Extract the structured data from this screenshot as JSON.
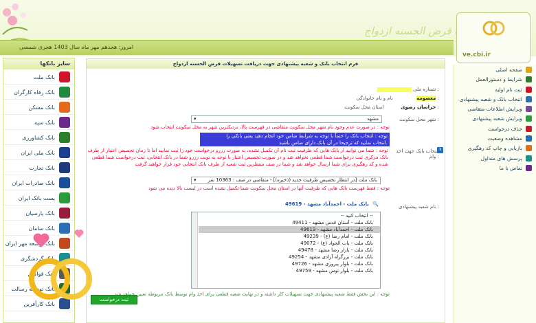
{
  "header": {
    "brand_text": "سامانه تسهیلات قرض الحسنه ازدواج",
    "logo_text": "ve.cbi.ir",
    "date_text": "امروز: هجدهم مهر ماه سال 1403 هجری شمسی"
  },
  "left_sidebar": {
    "title": "سایر بانکها",
    "banks": [
      {
        "label": "بانک ملت",
        "color": "#d0152a"
      },
      {
        "label": "بانک رفاه کارگران",
        "color": "#1f8a3b"
      },
      {
        "label": "بانک مسکن",
        "color": "#e36b1b"
      },
      {
        "label": "بانک سپه",
        "color": "#6b2a8b"
      },
      {
        "label": "بانک کشاورزی",
        "color": "#2a7f2a"
      },
      {
        "label": "بانک ملی ایران",
        "color": "#1b3f8f"
      },
      {
        "label": "بانک تجارت",
        "color": "#1a3c7a"
      },
      {
        "label": "بانک صادرات ایران",
        "color": "#1b4e9a"
      },
      {
        "label": "پست بانک ایران",
        "color": "#2a9b3a"
      },
      {
        "label": "بانک پارسیان",
        "color": "#9a1b3a"
      },
      {
        "label": "بانک سامان",
        "color": "#2a6fb5"
      },
      {
        "label": "بانک توسعه مهر ایران",
        "color": "#c24a1a"
      },
      {
        "label": "بانک گردشگری",
        "color": "#1a8f8f"
      },
      {
        "label": "بانک قوامین",
        "color": "#5a5a5a"
      },
      {
        "label": "بانک توسعه رسالت",
        "color": "#1f6d2f"
      },
      {
        "label": "بانک کارآفرین",
        "color": "#2a4f8f"
      }
    ]
  },
  "form": {
    "title": "فرم انتخاب بانک و شعبه پیشنهادی جهت دریافت تسهیلات قرض الحسنه ازدواج",
    "national_code_label": "شماره ملی :",
    "name_label": "نام و نام خانوادگی :",
    "name_value": "معصومه",
    "province_label": "استان محل سکونت :",
    "province_value": "خراسان رضوی",
    "city_label": "شهر محل سکونت :",
    "city_value": "مشهد",
    "city_note": "توجه : در صورت عدم وجود نام شهر محل سکونت متقاضی در فهرست بالا، نزدیکترین شهر به محل سکونت انتخاب شود",
    "blue_note_1": "توجه : انتخاب بانک را حتماً با توجه به شرایط ضامن خود انجام دهید یعنی بانکی را",
    "blue_note_2": "انتخاب نمایید که ترجیحا در آن بانک دارای ضامن باشید.",
    "bank_select_label": "انتخاب بانک جهت اخذ وام :",
    "bank_warning": "توجه : شما می توانید از بانک هایی که ظرفیت ثبت نام آن تکمیل نشده، به صورت رزرو درخواست خود را ثبت نمایید اما تا زمان تخصیص اعتبار از طرف بانک مرکزی ثبت درخواست شما قطعی نخواهد شد و در صورت تخصیص اعتبار با توجه به نوبت رزرو شما در بانک انتخابی، ثبت درخواست شما قطعی شده و کد رهگیری برای شما ارسال خواهد شد و شما در صف منتظرین ثبت شعبه از طرف بانک انتخابی خود قرار خواهید گرفت",
    "bank_select_value": "بانک ملت [در انتظار تخصیص ظرفیت جدید (ذخیره)] - متقاضی در صف : 10363 نفر",
    "bank_note": "توجه : فقط فهرست بانک هایی که ظرفیت آنها در استان محل سکونت شما تکمیل نشده است در لیست بالا دیده می شود",
    "branch_label": "نام شعبه پیشنهادی :",
    "branch_selected": "بانک ملت - احمدآباد مشهد - 49619",
    "branch_options": [
      "-- انتخاب کنید --",
      "بانک ملت - آستان قدس مشهد - 49411",
      "بانک ملت - احمدآباد مشهد - 49619",
      "بانک ملت - امام رضا (ع) - 49239",
      "بانک ملت - باب الجواد (ع) - 49072",
      "بانک ملت - بازار رضا مشهد - 49478",
      "بانک ملت - بزرگراه آزادی مشهد - 49254",
      "بانک ملت - بلوار پیروزی مشهد - 49726",
      "بانک ملت - بلوار توس مشهد - 49759"
    ],
    "branch_note": "توجه : این بخش فقط شعبه پیشنهادی جهت تسهیلات کار داشته و در نهایت شعبه قطعی برای اخذ وام توسط بانک مربوطه تعیین خواهد شد",
    "submit_label": "ثبت درخواست"
  },
  "right_sidebar": {
    "items": [
      "صفحه اصلی",
      "شرایط و دستورالعمل",
      "ثبت نام اولیه",
      "انتخاب بانک و شعبه پیشنهادی",
      "ویرایش اطلاعات متقاضی",
      "ویرایش شعبه پیشنهادی",
      "حذف درخواست",
      "مشاهده وضعیت",
      "بازیابی و چاپ کد رهگیری",
      "پرسش های متداول",
      "تماس با ما"
    ],
    "icon_colors": [
      "#e8a200",
      "#2a7f2a",
      "#d0152a",
      "#2a6fb5",
      "#7a4a9a",
      "#2a9b3a",
      "#d0152a",
      "#1b6fb5",
      "#e36b1b",
      "#1a8f8f",
      "#6b2a8b"
    ]
  }
}
